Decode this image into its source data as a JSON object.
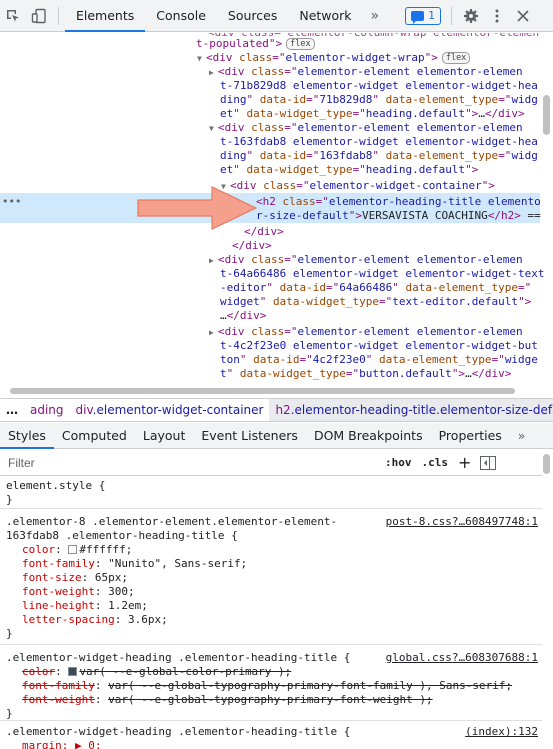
{
  "toolbar": {
    "tabs": [
      "Elements",
      "Console",
      "Sources",
      "Network"
    ],
    "more": "»",
    "issues_count": "1"
  },
  "dom_lines": [
    {
      "indent": 196,
      "parts": [
        [
          "tag",
          "t-populated\">"
        ],
        [
          "badge",
          "flex"
        ]
      ]
    },
    {
      "indent": 208,
      "tri": "▼",
      "parts": [
        [
          "tag",
          "<div "
        ],
        [
          "attr",
          "class"
        ],
        [
          "punc",
          "=\""
        ],
        [
          "val",
          "elementor-widget-wrap"
        ],
        [
          "punc",
          "\">"
        ],
        [
          "badge",
          "flex"
        ]
      ]
    },
    {
      "indent": 220,
      "tri": "▶",
      "parts": [
        [
          "tag",
          "<div "
        ],
        [
          "attr",
          "class"
        ],
        [
          "punc",
          "=\""
        ],
        [
          "val",
          "elementor-element elementor-elemen"
        ]
      ]
    },
    {
      "indent": 220,
      "parts": [
        [
          "val",
          "t-71b829d8 elementor-widget elementor-widget-hea"
        ]
      ]
    },
    {
      "indent": 220,
      "parts": [
        [
          "val",
          "ding"
        ],
        [
          "punc",
          "\" "
        ],
        [
          "attr",
          "data-id"
        ],
        [
          "punc",
          "=\""
        ],
        [
          "val",
          "71b829d8"
        ],
        [
          "punc",
          "\" "
        ],
        [
          "attr",
          "data-element_type"
        ],
        [
          "punc",
          "=\""
        ],
        [
          "val",
          "widg"
        ]
      ]
    },
    {
      "indent": 220,
      "parts": [
        [
          "val",
          "et"
        ],
        [
          "punc",
          "\" "
        ],
        [
          "attr",
          "data-widget_type"
        ],
        [
          "punc",
          "=\""
        ],
        [
          "val",
          "heading.default"
        ],
        [
          "punc",
          "\">"
        ],
        [
          "txt",
          "…"
        ],
        [
          "tag",
          "</div>"
        ]
      ]
    },
    {
      "indent": 220,
      "tri": "▼",
      "parts": [
        [
          "tag",
          "<div "
        ],
        [
          "attr",
          "class"
        ],
        [
          "punc",
          "=\""
        ],
        [
          "val",
          "elementor-element elementor-elemen"
        ]
      ]
    },
    {
      "indent": 220,
      "parts": [
        [
          "val",
          "t-163fdab8 elementor-widget elementor-widget-hea"
        ]
      ]
    },
    {
      "indent": 220,
      "parts": [
        [
          "val",
          "ding"
        ],
        [
          "punc",
          "\" "
        ],
        [
          "attr",
          "data-id"
        ],
        [
          "punc",
          "=\""
        ],
        [
          "val",
          "163fdab8"
        ],
        [
          "punc",
          "\" "
        ],
        [
          "attr",
          "data-element_type"
        ],
        [
          "punc",
          "=\""
        ],
        [
          "val",
          "widg"
        ]
      ]
    },
    {
      "indent": 220,
      "parts": [
        [
          "val",
          "et"
        ],
        [
          "punc",
          "\" "
        ],
        [
          "attr",
          "data-widget_type"
        ],
        [
          "punc",
          "=\""
        ],
        [
          "val",
          "heading.default"
        ],
        [
          "punc",
          "\">"
        ]
      ]
    },
    {
      "indent": 232,
      "tri": "▼",
      "parts": [
        [
          "tag",
          "<div "
        ],
        [
          "attr",
          "class"
        ],
        [
          "punc",
          "=\""
        ],
        [
          "val",
          "elementor-widget-container"
        ],
        [
          "punc",
          "\">"
        ]
      ]
    },
    {
      "indent": 256,
      "parts": [
        [
          "tag",
          "<h2 "
        ],
        [
          "attr",
          "class"
        ],
        [
          "punc",
          "=\""
        ],
        [
          "val",
          "elementor-heading-title elemento"
        ]
      ]
    },
    {
      "indent": 256,
      "parts": [
        [
          "val",
          "r-size-default"
        ],
        [
          "punc",
          "\">"
        ],
        [
          "txt",
          "VERSAVISTA COACHING"
        ],
        [
          "tag",
          "</h2>"
        ],
        [
          "txt",
          " =="
        ]
      ]
    },
    {
      "indent": 244,
      "parts": [
        [
          "tag",
          "</div>"
        ]
      ]
    },
    {
      "indent": 232,
      "parts": [
        [
          "tag",
          "</div>"
        ]
      ]
    },
    {
      "indent": 220,
      "tri": "▶",
      "parts": [
        [
          "tag",
          "<div "
        ],
        [
          "attr",
          "class"
        ],
        [
          "punc",
          "=\""
        ],
        [
          "val",
          "elementor-element elementor-elemen"
        ]
      ]
    },
    {
      "indent": 220,
      "parts": [
        [
          "val",
          "t-64a66486 elementor-widget elementor-widget-text"
        ]
      ]
    },
    {
      "indent": 220,
      "parts": [
        [
          "val",
          "-editor"
        ],
        [
          "punc",
          "\" "
        ],
        [
          "attr",
          "data-id"
        ],
        [
          "punc",
          "=\""
        ],
        [
          "val",
          "64a66486"
        ],
        [
          "punc",
          "\" "
        ],
        [
          "attr",
          "data-element_type"
        ],
        [
          "punc",
          "=\""
        ]
      ]
    },
    {
      "indent": 220,
      "parts": [
        [
          "val",
          "widget"
        ],
        [
          "punc",
          "\" "
        ],
        [
          "attr",
          "data-widget_type"
        ],
        [
          "punc",
          "=\""
        ],
        [
          "val",
          "text-editor.default"
        ],
        [
          "punc",
          "\">"
        ]
      ]
    },
    {
      "indent": 220,
      "parts": [
        [
          "txt",
          "…"
        ],
        [
          "tag",
          "</div>"
        ]
      ]
    },
    {
      "indent": 220,
      "tri": "▶",
      "parts": [
        [
          "tag",
          "<div "
        ],
        [
          "attr",
          "class"
        ],
        [
          "punc",
          "=\""
        ],
        [
          "val",
          "elementor-element elementor-elemen"
        ]
      ]
    },
    {
      "indent": 220,
      "parts": [
        [
          "val",
          "t-4c2f23e0 elementor-widget elementor-widget-but"
        ]
      ]
    },
    {
      "indent": 220,
      "parts": [
        [
          "val",
          "ton"
        ],
        [
          "punc",
          "\" "
        ],
        [
          "attr",
          "data-id"
        ],
        [
          "punc",
          "=\""
        ],
        [
          "val",
          "4c2f23e0"
        ],
        [
          "punc",
          "\" "
        ],
        [
          "attr",
          "data-element_type"
        ],
        [
          "punc",
          "=\""
        ],
        [
          "val",
          "widge"
        ]
      ]
    },
    {
      "indent": 220,
      "parts": [
        [
          "val",
          "t"
        ],
        [
          "punc",
          "\" "
        ],
        [
          "attr",
          "data-widget_type"
        ],
        [
          "punc",
          "=\""
        ],
        [
          "val",
          "button.default"
        ],
        [
          "punc",
          "\">"
        ],
        [
          "txt",
          "…"
        ],
        [
          "tag",
          "</div>"
        ]
      ]
    }
  ],
  "breadcrumb": {
    "dots": "…",
    "c0": "ading",
    "c1_tag": "div",
    "c1_class": ".elementor-widget-container",
    "c2_tag": "h2",
    "c2_class": ".elementor-heading-title.elementor-size-default"
  },
  "styles_tabs": [
    "Styles",
    "Computed",
    "Layout",
    "Event Listeners",
    "DOM Breakpoints",
    "Properties"
  ],
  "styles_more": "»",
  "filter": {
    "placeholder": "Filter",
    "hov": ":hov",
    "cls": ".cls",
    "plus": "+"
  },
  "rules": {
    "r0_selector": "element.style {",
    "r0_close": "}",
    "r1_selector_a": ".elementor-8 .elementor-element.elementor-element-",
    "r1_selector_b": "163fdab8 .elementor-heading-title {",
    "r1_source": "post-8.css?…608497748:1",
    "r1_props": [
      {
        "name": "color",
        "value": "#ffffff",
        "swatch": "#ffffff"
      },
      {
        "name": "font-family",
        "value": "\"Nunito\", Sans-serif"
      },
      {
        "name": "font-size",
        "value": "65px"
      },
      {
        "name": "font-weight",
        "value": "300"
      },
      {
        "name": "line-height",
        "value": "1.2em"
      },
      {
        "name": "letter-spacing",
        "value": "3.6px"
      }
    ],
    "r1_close": "}",
    "r2_selector": ".elementor-widget-heading .elementor-heading-title {",
    "r2_source": "global.css?…608307688:1",
    "r2_props": [
      {
        "name": "color",
        "value": "var( --e-global-color-primary );",
        "swatch": "#3a4a5a"
      },
      {
        "name": "font-family",
        "value": "var( --e-global-typography-primary-font-family ), Sans-serif"
      },
      {
        "name": "font-weight",
        "value": "var( --e-global-typography-primary-font-weight );"
      }
    ],
    "r2_close": "}",
    "r3_selector": ".elementor-widget-heading .elementor-heading-title {",
    "r3_source": "(index):132",
    "r3_partial": "margin: ▶ 0;"
  },
  "colors": {
    "accent": "#1a73e8",
    "tag": "#881280",
    "attr": "#994500",
    "value": "#1a1aa6",
    "property": "#c80000",
    "selected_row": "#cfe8fc",
    "arrow": "#f4a08c"
  }
}
